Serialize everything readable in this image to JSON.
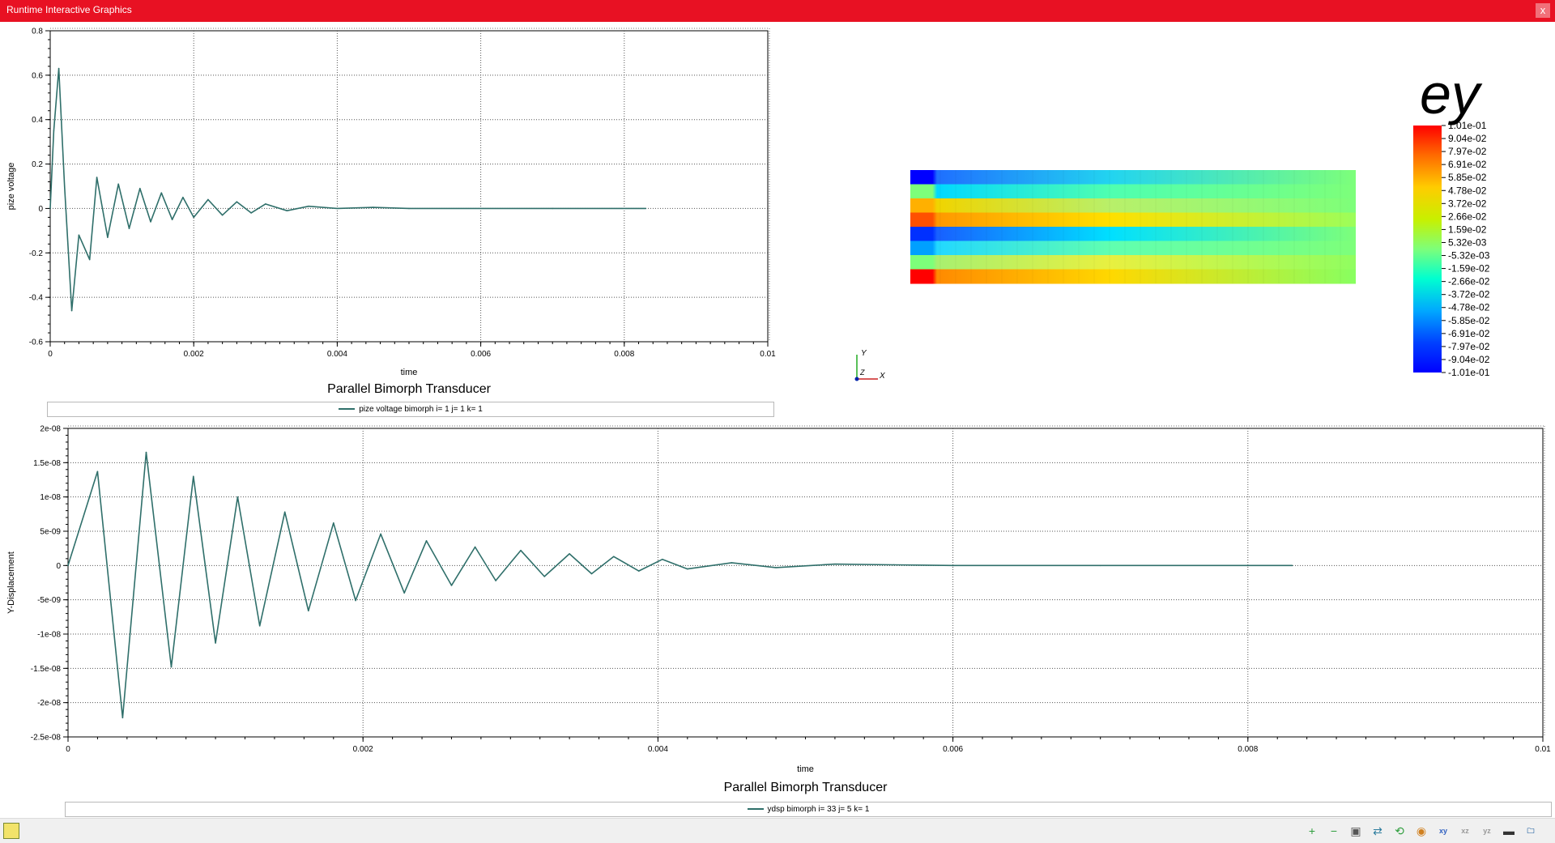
{
  "window": {
    "title": "Runtime Interactive Graphics",
    "close_label": "x"
  },
  "plot1": {
    "title": "Parallel Bimorph Transducer",
    "xlabel": "time",
    "ylabel": "pize voltage",
    "legend": "pize voltage bimorph i= 1 j= 1 k= 1",
    "xticks": [
      "0",
      "0.002",
      "0.004",
      "0.006",
      "0.008",
      "0.01"
    ],
    "yticks": [
      "0.8",
      "0.6",
      "0.4",
      "0.2",
      "0",
      "-0.2",
      "-0.4",
      "-0.6"
    ]
  },
  "plot2": {
    "title": "Parallel Bimorph Transducer",
    "xlabel": "time",
    "ylabel": "Y-Displacement",
    "legend": "ydsp bimorph i= 33 j= 5 k= 1",
    "xticks": [
      "0",
      "0.002",
      "0.004",
      "0.006",
      "0.008",
      "0.01"
    ],
    "yticks": [
      "2e-08",
      "1.5e-08",
      "1e-08",
      "5e-09",
      "0",
      "-5e-09",
      "-1e-08",
      "-1.5e-08",
      "-2e-08",
      "-2.5e-08"
    ]
  },
  "contour": {
    "variable": "ey",
    "colorbar_labels": [
      "1.01e-01",
      "9.04e-02",
      "7.97e-02",
      "6.91e-02",
      "5.85e-02",
      "4.78e-02",
      "3.72e-02",
      "2.66e-02",
      "1.59e-02",
      "5.32e-03",
      "-5.32e-03",
      "-1.59e-02",
      "-2.66e-02",
      "-3.72e-02",
      "-4.78e-02",
      "-5.85e-02",
      "-6.91e-02",
      "-7.97e-02",
      "-9.04e-02",
      "-1.01e-01"
    ],
    "axis_y": "Y",
    "axis_z": "Z",
    "axis_x": "X"
  },
  "chart_data": [
    {
      "type": "line",
      "title": "Parallel Bimorph Transducer",
      "xlabel": "time",
      "ylabel": "pize voltage",
      "xlim": [
        0,
        0.01
      ],
      "ylim": [
        -0.6,
        0.8
      ],
      "grid": true,
      "legend_position": "bottom",
      "series": [
        {
          "name": "pize voltage bimorph i= 1 j= 1 k= 1",
          "color": "#2f6f6a",
          "x": [
            0,
            5e-05,
            0.00012,
            0.0002,
            0.0003,
            0.0004,
            0.00055,
            0.00065,
            0.0008,
            0.00095,
            0.0011,
            0.00125,
            0.0014,
            0.00155,
            0.0017,
            0.00185,
            0.002,
            0.0022,
            0.0024,
            0.0026,
            0.0028,
            0.003,
            0.0033,
            0.0036,
            0.004,
            0.0045,
            0.005,
            0.006,
            0.007,
            0.0083
          ],
          "y": [
            0,
            0.35,
            0.63,
            0.1,
            -0.46,
            -0.12,
            -0.23,
            0.14,
            -0.13,
            0.11,
            -0.09,
            0.09,
            -0.06,
            0.07,
            -0.05,
            0.05,
            -0.04,
            0.04,
            -0.03,
            0.03,
            -0.02,
            0.02,
            -0.01,
            0.01,
            0,
            0.005,
            0,
            0,
            0,
            0
          ]
        }
      ]
    },
    {
      "type": "line",
      "title": "Parallel Bimorph Transducer",
      "xlabel": "time",
      "ylabel": "Y-Displacement",
      "xlim": [
        0,
        0.01
      ],
      "ylim": [
        -2.5e-08,
        2e-08
      ],
      "grid": true,
      "legend_position": "bottom",
      "series": [
        {
          "name": "ydsp bimorph i= 33 j= 5 k= 1",
          "color": "#2f6f6a",
          "x": [
            0,
            0.0002,
            0.00037,
            0.00053,
            0.0007,
            0.00085,
            0.001,
            0.00115,
            0.0013,
            0.00147,
            0.00163,
            0.0018,
            0.00195,
            0.00212,
            0.00228,
            0.00243,
            0.0026,
            0.00276,
            0.0029,
            0.00307,
            0.00323,
            0.0034,
            0.00355,
            0.0037,
            0.00387,
            0.00403,
            0.0042,
            0.0045,
            0.0048,
            0.0052,
            0.0056,
            0.006,
            0.007,
            0.0083
          ],
          "y": [
            0,
            1.37e-08,
            -2.22e-08,
            1.65e-08,
            -1.48e-08,
            1.3e-08,
            -1.13e-08,
            1e-08,
            -8.8e-09,
            7.8e-09,
            -6.6e-09,
            6.2e-09,
            -5.1e-09,
            4.6e-09,
            -4e-09,
            3.6e-09,
            -2.9e-09,
            2.7e-09,
            -2.2e-09,
            2.2e-09,
            -1.6e-09,
            1.7e-09,
            -1.2e-09,
            1.3e-09,
            -8e-10,
            9e-10,
            -5e-10,
            4e-10,
            -3e-10,
            2e-10,
            1e-10,
            0,
            0,
            0
          ]
        }
      ]
    }
  ],
  "toolbar": {
    "icons": [
      "zoom-in-icon",
      "zoom-out-icon",
      "cube-view-icon",
      "move-icon",
      "rotate-icon",
      "color-icon",
      "view-xy-icon",
      "view-xz-icon",
      "view-yz-icon",
      "camera-icon",
      "save-icon"
    ],
    "glyphs": [
      "+",
      "−",
      "▣",
      "⇄",
      "⟲",
      "◉",
      "xy",
      "xz",
      "yz",
      "▬",
      "🗀"
    ],
    "colors": [
      "#2e9e3d",
      "#2e9e3d",
      "#555555",
      "#2e7d9e",
      "#2e9e3d",
      "#d08020",
      "#3060c0",
      "#999999",
      "#999999",
      "#333333",
      "#2060a0"
    ]
  }
}
